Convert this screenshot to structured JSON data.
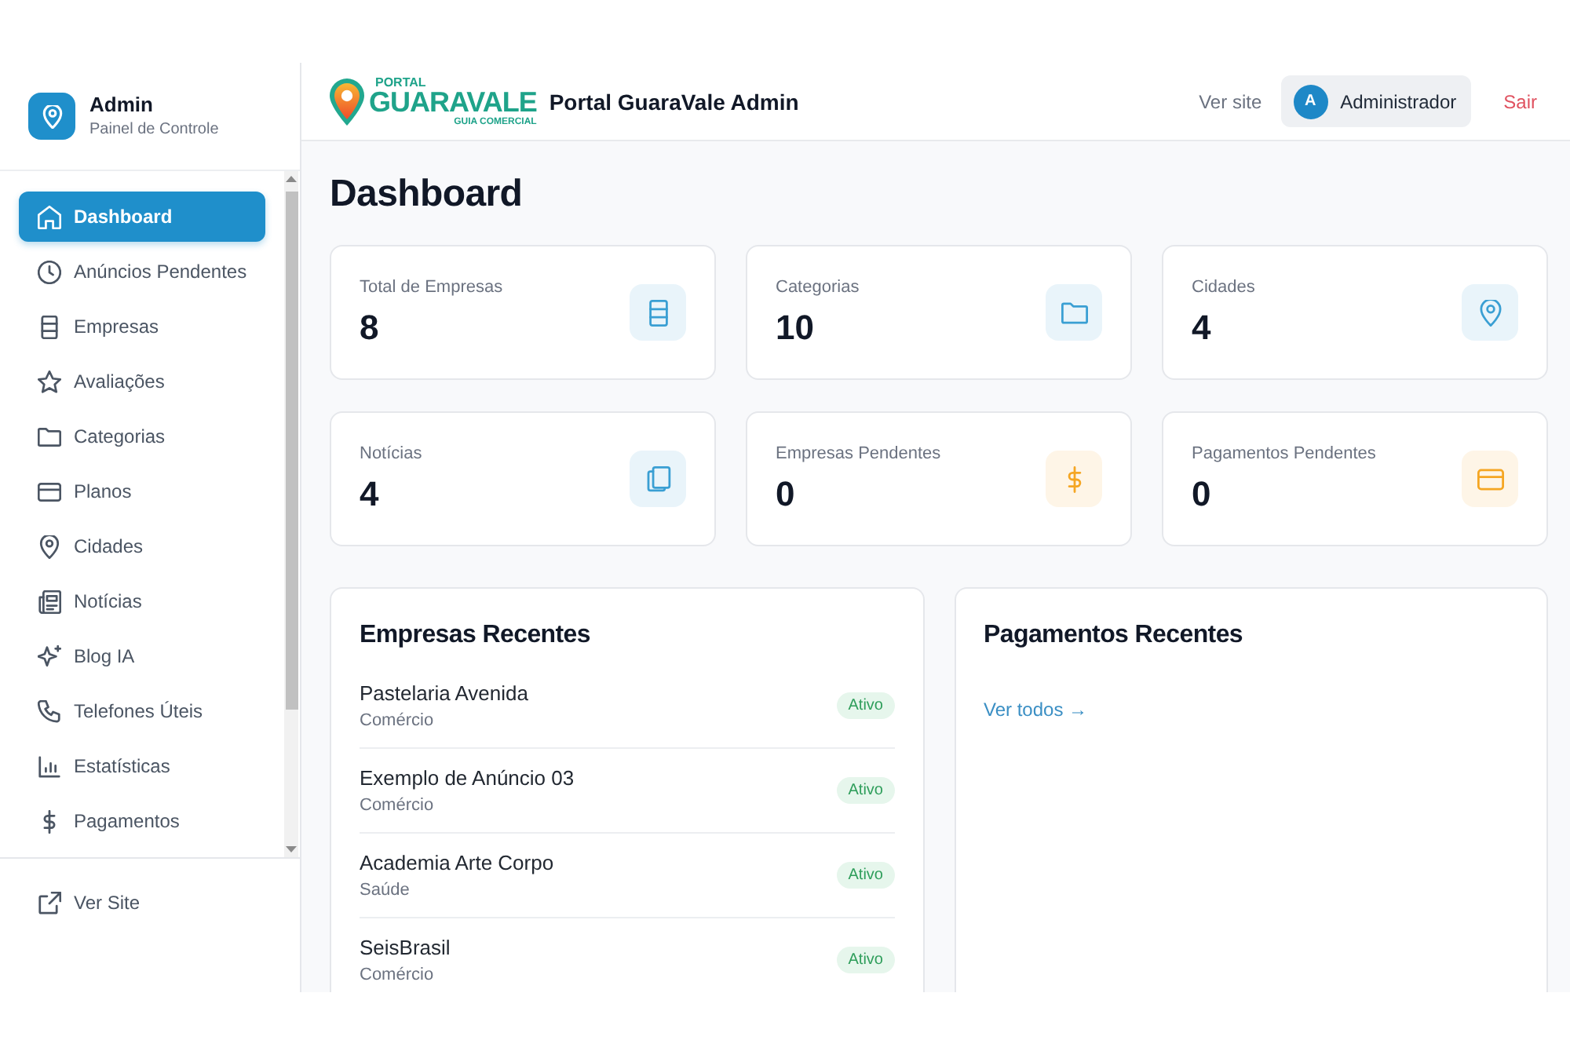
{
  "sidebar": {
    "brand": {
      "title": "Admin",
      "subtitle": "Painel de Controle"
    },
    "items": [
      {
        "label": "Dashboard",
        "selected": true
      },
      {
        "label": "Anúncios Pendentes",
        "selected": false
      },
      {
        "label": "Empresas",
        "selected": false
      },
      {
        "label": "Avaliações",
        "selected": false
      },
      {
        "label": "Categorias",
        "selected": false
      },
      {
        "label": "Planos",
        "selected": false
      },
      {
        "label": "Cidades",
        "selected": false
      },
      {
        "label": "Notícias",
        "selected": false
      },
      {
        "label": "Blog IA",
        "selected": false
      },
      {
        "label": "Telefones Úteis",
        "selected": false
      },
      {
        "label": "Estatísticas",
        "selected": false
      },
      {
        "label": "Pagamentos",
        "selected": false
      }
    ],
    "footer_link": "Ver Site"
  },
  "header": {
    "logo": {
      "caption": "PORTAL",
      "wordmark": "GUARAVALE",
      "tagline": "GUIA COMERCIAL"
    },
    "title": "Portal GuaraVale Admin",
    "site_link": "Ver site",
    "user": {
      "initial": "A",
      "name": "Administrador"
    },
    "logout": "Sair"
  },
  "page_title": "Dashboard",
  "stats": [
    {
      "label": "Total de Empresas",
      "value": "8",
      "color": "#3a9fd3"
    },
    {
      "label": "Categorias",
      "value": "10",
      "color": "#3a9fd3"
    },
    {
      "label": "Cidades",
      "value": "4",
      "color": "#3a9fd3"
    },
    {
      "label": "Notícias",
      "value": "4",
      "color": "#3a9fd3"
    },
    {
      "label": "Empresas Pendentes",
      "value": "0",
      "color": "#f5a623"
    },
    {
      "label": "Pagamentos Pendentes",
      "value": "0",
      "color": "#f5a623"
    }
  ],
  "recent_companies": {
    "title": "Empresas Recentes",
    "rows": [
      {
        "name": "Pastelaria Avenida",
        "category": "Comércio",
        "status": "Ativo"
      },
      {
        "name": "Exemplo de Anúncio 03",
        "category": "Comércio",
        "status": "Ativo"
      },
      {
        "name": "Academia Arte Corpo",
        "category": "Saúde",
        "status": "Ativo"
      },
      {
        "name": "SeisBrasil",
        "category": "Comércio",
        "status": "Ativo"
      }
    ]
  },
  "recent_payments": {
    "title": "Pagamentos Recentes",
    "link": "Ver todos →"
  }
}
